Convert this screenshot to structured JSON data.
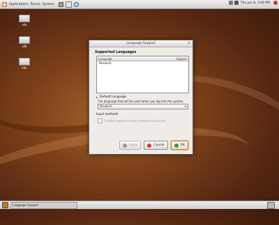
{
  "desktop": {
    "icons": [
      {
        "label": "sda"
      },
      {
        "label": "sdb"
      },
      {
        "label": "hdc"
      }
    ]
  },
  "top_panel": {
    "menus": [
      "Applications",
      "Places",
      "System"
    ],
    "clock": "Thu Jun 8, 3:06 PM"
  },
  "dialog": {
    "title": "Language Support",
    "supported_label": "Supported Languages",
    "list_header_language": "Language",
    "list_header_support": "Support",
    "languages": [
      "Deutsch"
    ],
    "default_label": "Default Language",
    "default_desc": "The language that will be used when you log into the system",
    "default_value": "Deutsch",
    "input_label": "Input methods",
    "input_checkbox_label": "Enable support to enter complex characters",
    "buttons": {
      "apply": "Apply",
      "cancel": "Cancel",
      "ok": "OK"
    }
  },
  "bottom_panel": {
    "tasks": [
      "Language Support"
    ]
  },
  "colors": {
    "accent": "#c08542",
    "apply_icon": "#9a9a9a",
    "cancel_icon": "#d23a2a",
    "ok_icon": "#3f9a2a"
  }
}
